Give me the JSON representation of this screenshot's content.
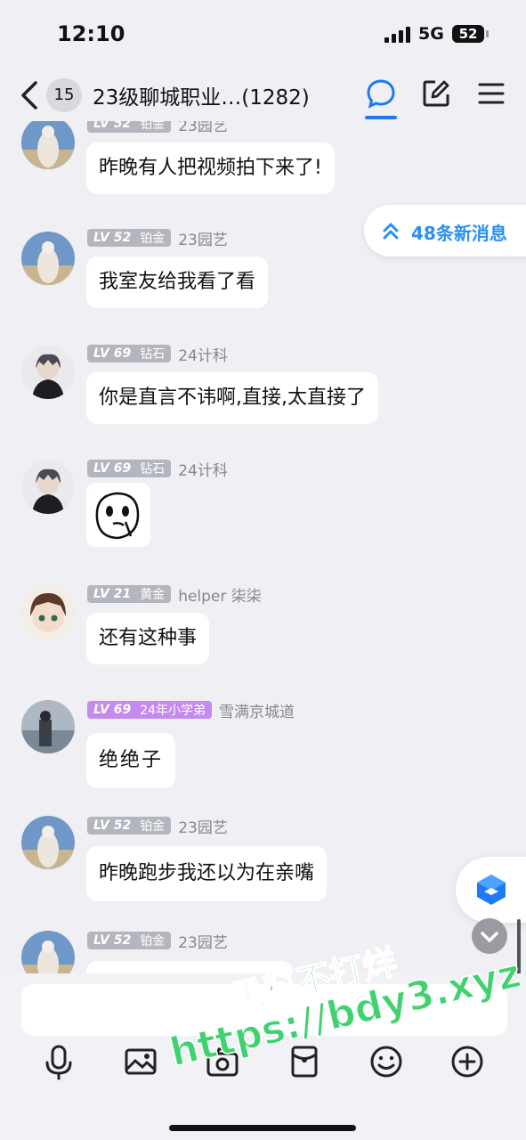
{
  "status_bar": {
    "time": "12:10",
    "network": "5G",
    "battery": "52"
  },
  "header": {
    "unread_badge": "15",
    "title": "23级聊城职业…(1282)"
  },
  "new_messages": {
    "label": "48条新消息"
  },
  "messages": [
    {
      "level": "LV 52",
      "rank": "铂金",
      "sender": "23园艺",
      "text": "昨晚有人把视频拍下来了!",
      "avatar": "statue-avatar"
    },
    {
      "level": "LV 52",
      "rank": "铂金",
      "sender": "23园艺",
      "text": "我室友给我看了看",
      "avatar": "statue-avatar"
    },
    {
      "level": "LV 69",
      "rank": "钻石",
      "sender": "24计科",
      "text": "你是直言不讳啊,直接,太直接了",
      "avatar": "anime-boy-avatar"
    },
    {
      "level": "LV 69",
      "rank": "钻石",
      "sender": "24计科",
      "text": "",
      "sticker": "face-sticker",
      "avatar": "anime-boy-avatar"
    },
    {
      "level": "LV 21",
      "rank": "黄金",
      "sender": "helper 柒柒",
      "text": "还有这种事",
      "avatar": "anime-girl-avatar"
    },
    {
      "level": "LV 69",
      "rank": "24年小学弟",
      "sender": "雪满京城道",
      "text": "绝绝子",
      "avatar": "photo-person-avatar"
    },
    {
      "level": "LV 52",
      "rank": "铂金",
      "sender": "23园艺",
      "text": "昨晚跑步我还以为在亲嘴",
      "avatar": "statue-avatar"
    },
    {
      "level": "LV 52",
      "rank": "铂金",
      "sender": "23园艺",
      "text": "",
      "avatar": "statue-avatar"
    }
  ],
  "composer": {
    "placeholder": ""
  },
  "toolbar": [
    "microphone-icon",
    "image-icon",
    "camera-icon",
    "red-packet-icon",
    "emoji-icon",
    "plus-icon"
  ],
  "watermark": {
    "line1": "黑料不打烊",
    "line2": "https://bdy3.xyz"
  },
  "colors": {
    "accent": "#1e7af0",
    "pill_text": "#2a8ff5",
    "background": "#efeff4",
    "level_badge": "#b4b6bf",
    "level_badge_special": "#c58af0",
    "watermark": "#3fd26e"
  }
}
